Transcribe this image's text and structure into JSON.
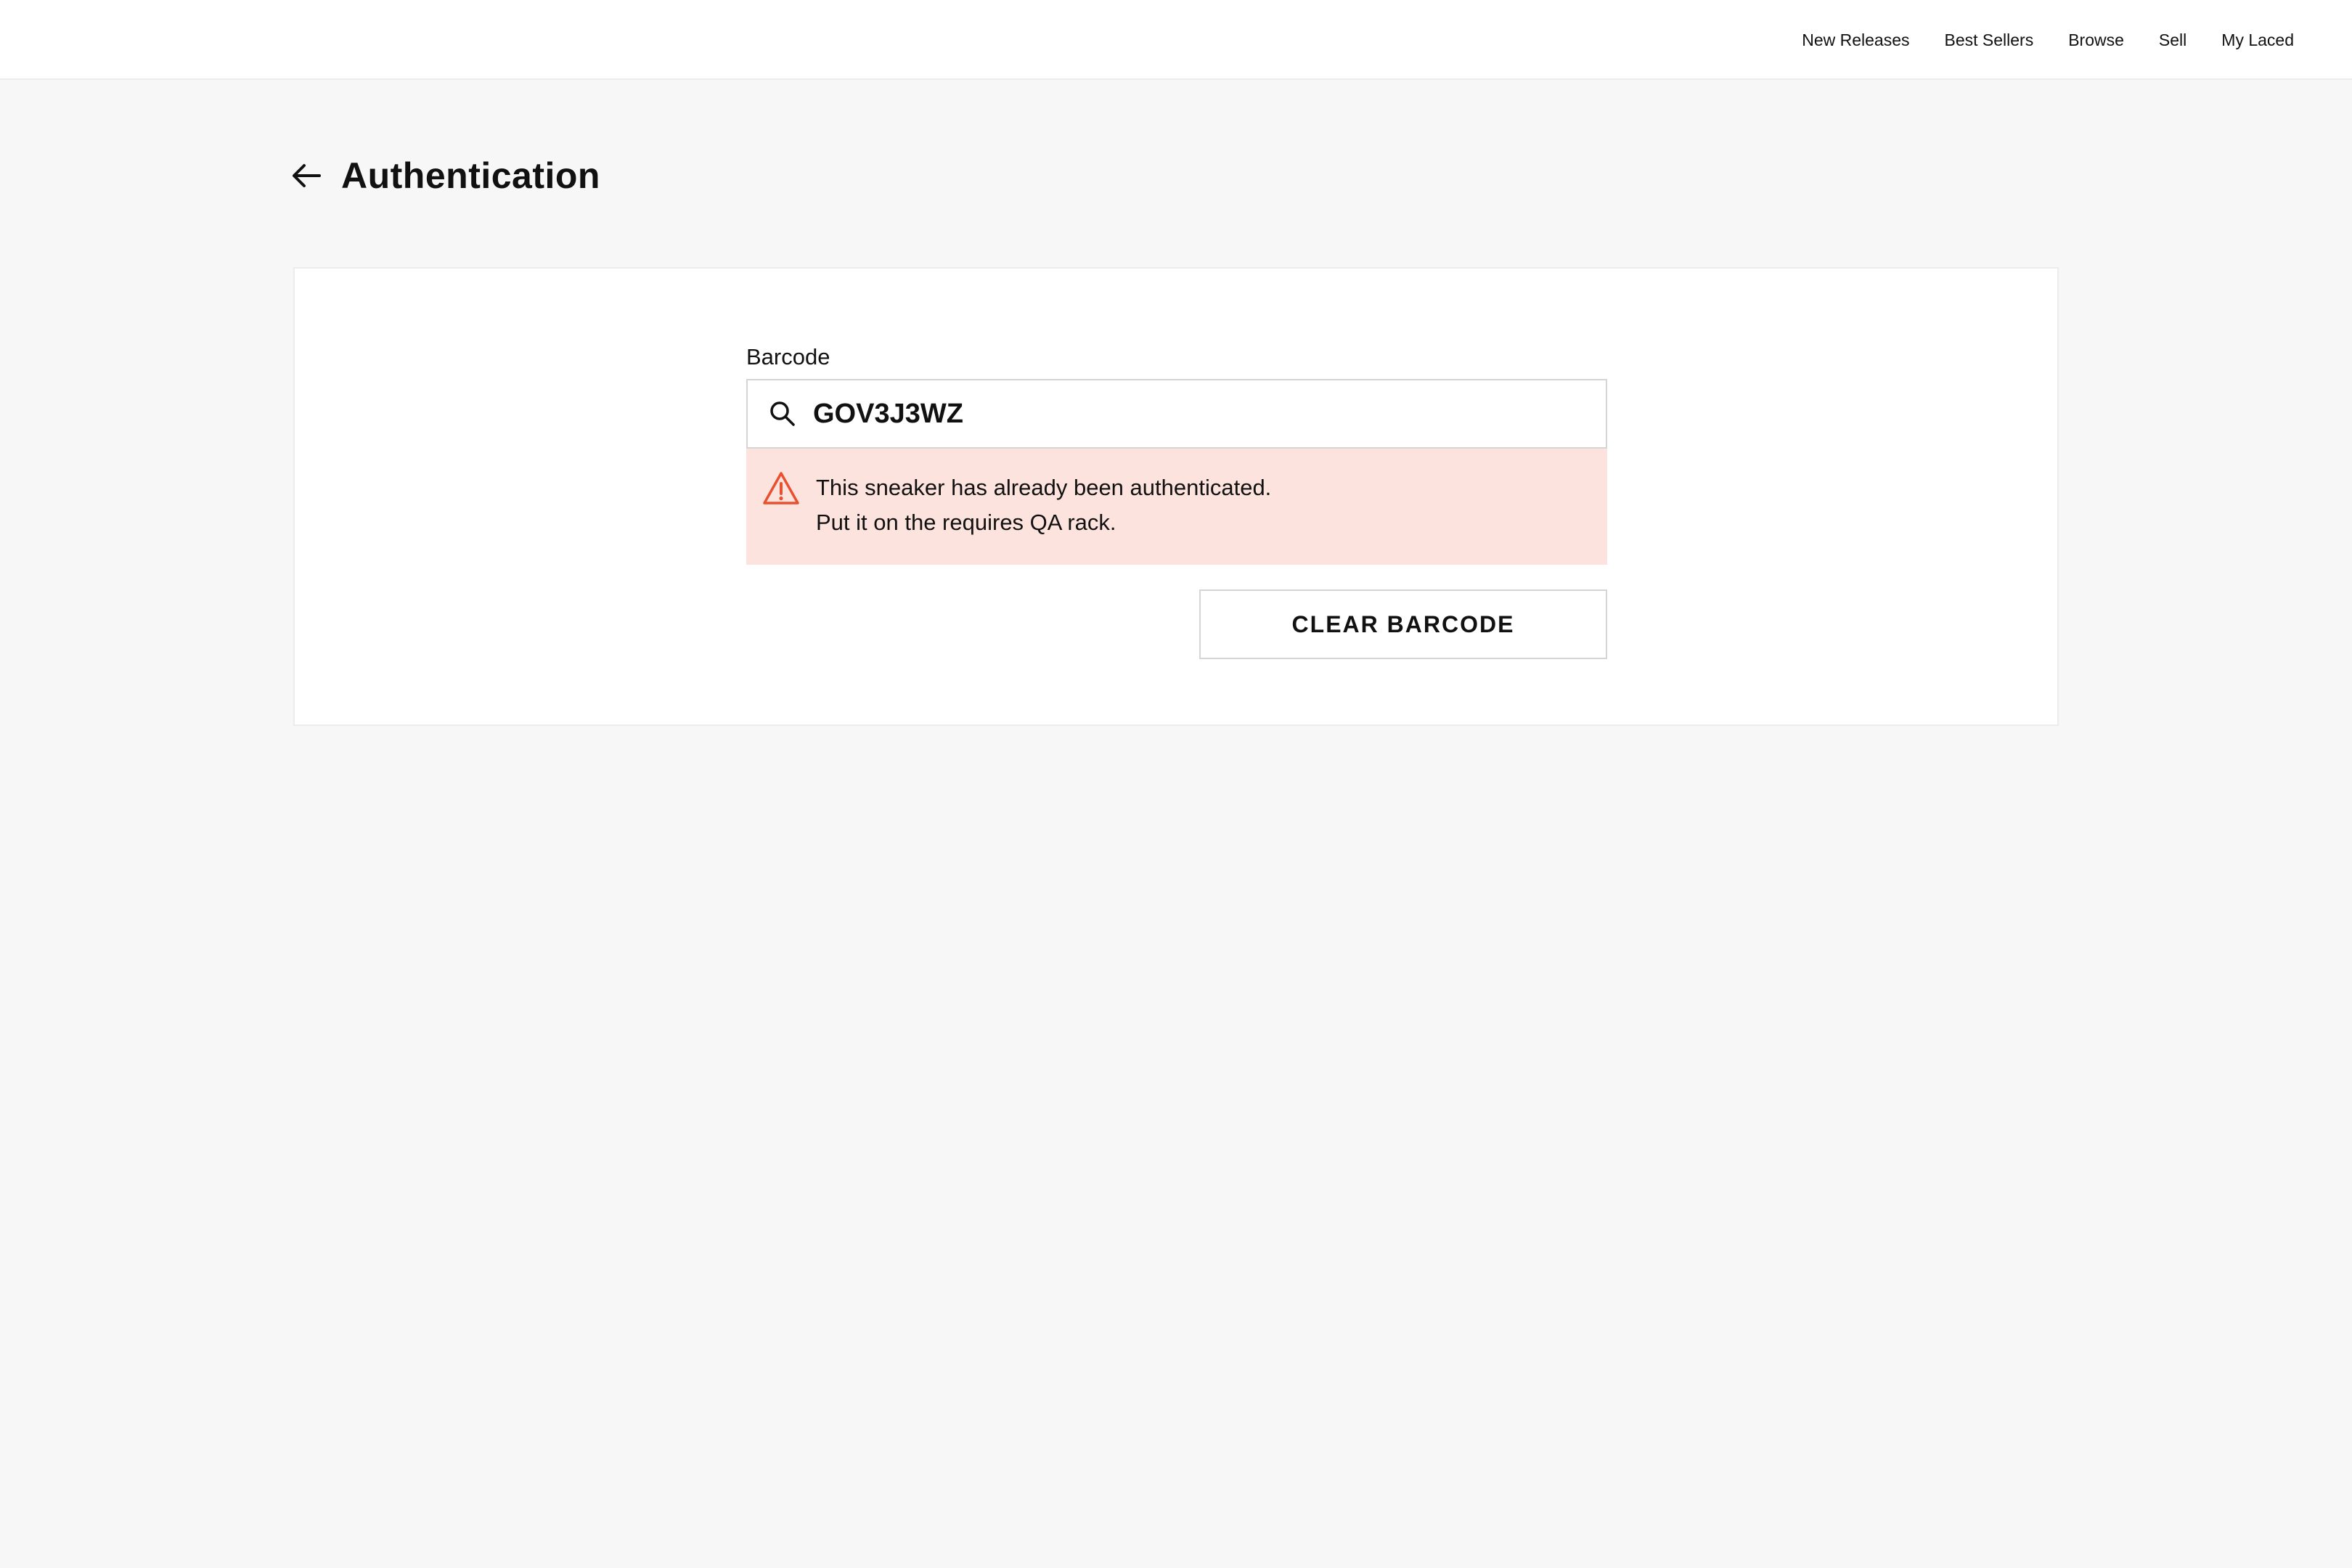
{
  "nav": {
    "items": [
      {
        "label": "New Releases"
      },
      {
        "label": "Best Sellers"
      },
      {
        "label": "Browse"
      },
      {
        "label": "Sell"
      },
      {
        "label": "My Laced"
      }
    ]
  },
  "header": {
    "title": "Authentication",
    "back_icon": "arrow-left-icon"
  },
  "form": {
    "barcode_label": "Barcode",
    "search_icon": "search-icon",
    "barcode_value": "GOV3J3WZ",
    "alert": {
      "icon": "warning-icon",
      "line1": "This sneaker has already been authenticated.",
      "line2": "Put it on the requires QA rack."
    },
    "clear_button_label": "CLEAR BARCODE"
  },
  "colors": {
    "page_background": "#f7f7f7",
    "card_background": "#ffffff",
    "alert_background": "#fde3dd",
    "warning_accent": "#e8502f",
    "text": "#111111"
  }
}
